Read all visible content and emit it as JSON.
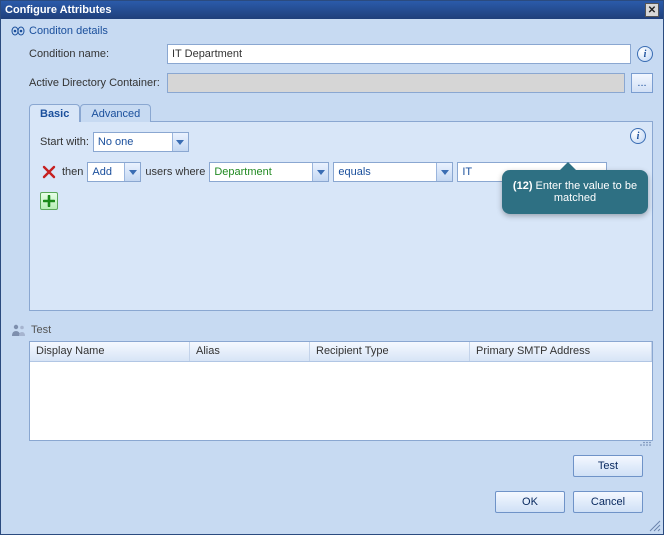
{
  "page_title": "Configure Attributes",
  "section_details": "Conditon details",
  "labels": {
    "condition_name": "Condition name:",
    "ad_container": "Active Directory Container:",
    "start_with": "Start with:",
    "then": "then",
    "users_where": "users where"
  },
  "fields": {
    "condition_name": "IT Department",
    "ad_container": "",
    "start_with": "No one",
    "action": "Add",
    "attribute": "Department",
    "operator": "equals",
    "value": "IT"
  },
  "tabs": {
    "basic": "Basic",
    "advanced": "Advanced"
  },
  "browse_label": "...",
  "callout": {
    "num": "(12)",
    "text": "Enter the value to be matched"
  },
  "test": {
    "title": "Test",
    "columns": {
      "display_name": "Display Name",
      "alias": "Alias",
      "recipient_type": "Recipient Type",
      "smtp": "Primary SMTP Address"
    },
    "test_btn": "Test"
  },
  "buttons": {
    "ok": "OK",
    "cancel": "Cancel"
  },
  "icons": {
    "close": "✕",
    "info": "i"
  }
}
